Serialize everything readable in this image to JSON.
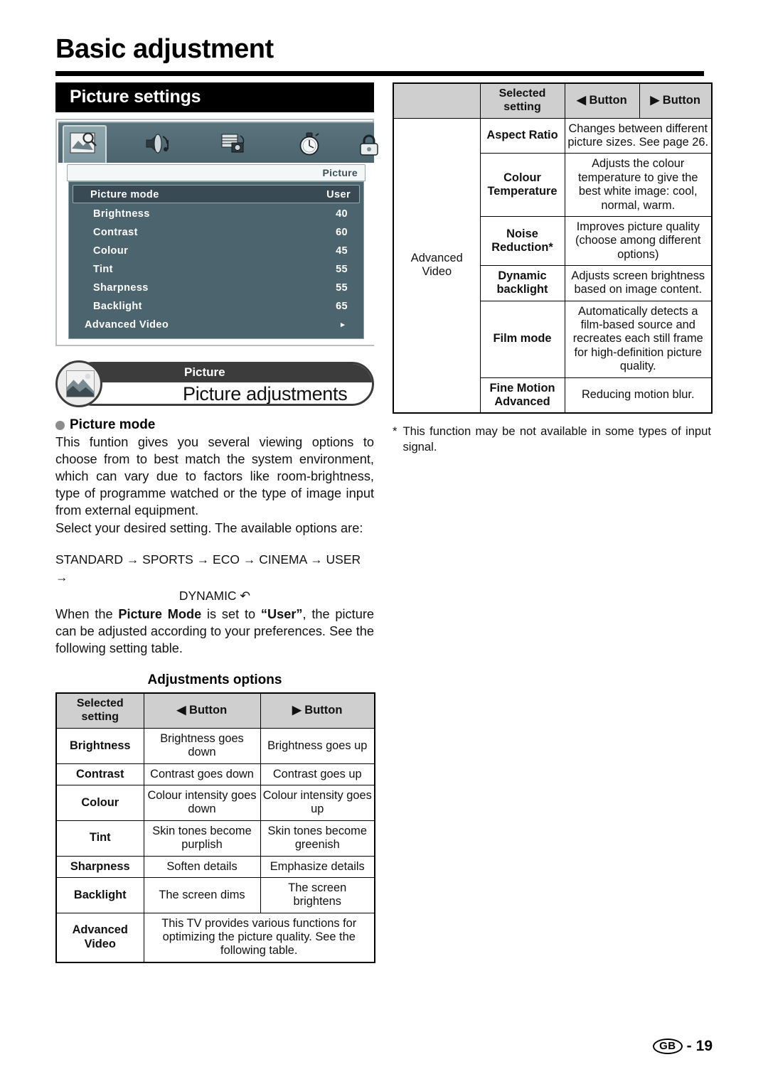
{
  "page": {
    "title": "Basic adjustment",
    "footer_locale": "GB",
    "footer_sep": "-",
    "footer_page": "19"
  },
  "section": {
    "heading": "Picture settings"
  },
  "osd": {
    "icons": [
      "picture-icon",
      "audio-icon",
      "setup-icon",
      "timer-icon",
      "lock-icon"
    ],
    "title": "Picture",
    "selected_row": {
      "label": "Picture mode",
      "value": "User"
    },
    "rows": [
      {
        "label": "Brightness",
        "value": "40"
      },
      {
        "label": "Contrast",
        "value": "60"
      },
      {
        "label": "Colour",
        "value": "45"
      },
      {
        "label": "Tint",
        "value": "55"
      },
      {
        "label": "Sharpness",
        "value": "55"
      },
      {
        "label": "Backlight",
        "value": "65"
      }
    ],
    "submenu_row": {
      "label": "Advanced Video",
      "arrow": "▸"
    }
  },
  "banner": {
    "kicker": "Picture",
    "title": "Picture adjustments",
    "badge_icon": "picture-thumbnail-icon"
  },
  "picture_mode": {
    "heading": "Picture mode",
    "paragraph_1": "This funtion gives you several viewing options to choose from to best match the system environment, which can vary due to factors like room-brightness, type of programme watched or the type of image input from external equipment.",
    "paragraph_2": "Select your desired setting. The available options are:",
    "flow_line_1": "STANDARD → SPORTS → ECO → CINEMA → USER →",
    "flow_line_2": "DYNAMIC ↶",
    "paragraph_3_a": "When the ",
    "paragraph_3_b": "Picture Mode",
    "paragraph_3_c": " is set to ",
    "paragraph_3_d": "“User”",
    "paragraph_3_e": ", the picture can be adjusted according to your preferences. See the following setting table."
  },
  "adjustments_table": {
    "caption": "Adjustments options",
    "headers": {
      "selected": "Selected setting",
      "left_button": "◀ Button",
      "right_button": "▶ Button"
    },
    "rows": [
      {
        "setting": "Brightness",
        "left": "Brightness goes down",
        "right": "Brightness goes up"
      },
      {
        "setting": "Contrast",
        "left": "Contrast goes down",
        "right": "Contrast goes up"
      },
      {
        "setting": "Colour",
        "left": "Colour intensity goes down",
        "right": "Colour intensity goes up"
      },
      {
        "setting": "Tint",
        "left": "Skin tones become purplish",
        "right": "Skin tones become greenish"
      },
      {
        "setting": "Sharpness",
        "left": "Soften details",
        "right": "Emphasize details"
      },
      {
        "setting": "Backlight",
        "left": "The screen dims",
        "right": "The screen brightens"
      }
    ],
    "advanced_row": {
      "setting": "Advanced Video",
      "description": "This TV provides various functions for optimizing the picture quality. See the following table."
    }
  },
  "advanced_video_table": {
    "headers": {
      "group": "",
      "selected": "Selected setting",
      "left_button": "◀ Button",
      "right_button": "▶ Button"
    },
    "group_label": "Advanced Video",
    "rows": [
      {
        "setting": "Aspect Ratio",
        "description": "Changes between different picture sizes. See page 26."
      },
      {
        "setting": "Colour Temperature",
        "description": "Adjusts the colour temperature to give the best white image: cool, normal, warm."
      },
      {
        "setting": "Noise Reduction*",
        "description": "Improves picture quality (choose among different options)"
      },
      {
        "setting": "Dynamic backlight",
        "description": "Adjusts screen brightness based on image content."
      },
      {
        "setting": "Film mode",
        "description": "Automatically detects a film-based source and recreates each still frame for high-definition picture quality."
      },
      {
        "setting": "Fine Motion Advanced",
        "description": "Reducing motion blur."
      }
    ],
    "footnote_marker": "*",
    "footnote": "This function may be not available in some types of input signal."
  }
}
